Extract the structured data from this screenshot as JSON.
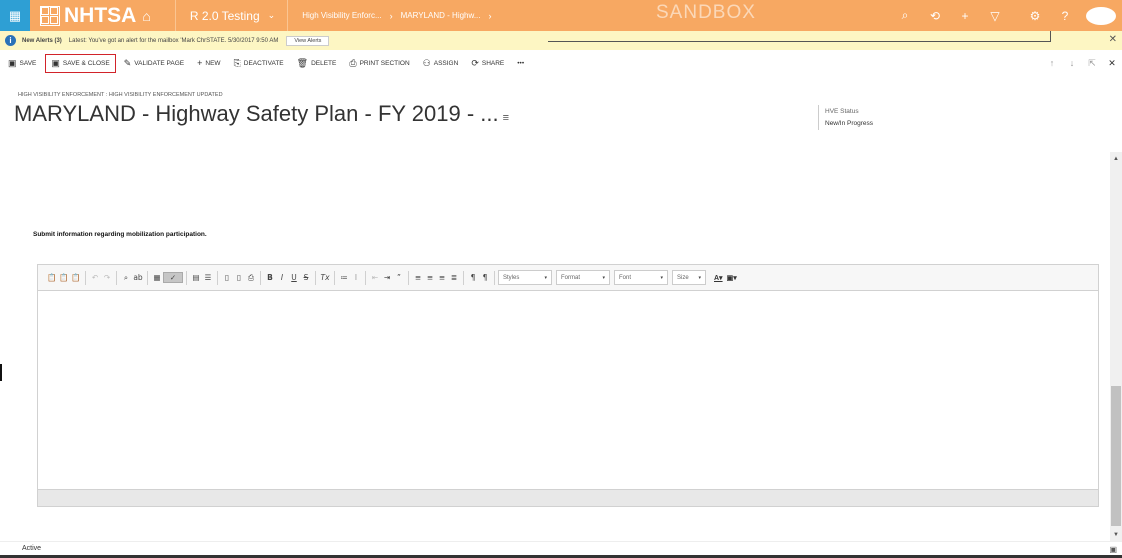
{
  "nav": {
    "logo": "NHTSA",
    "app_name": "R 2.0 Testing",
    "crumb_entity": "High Visibility Enforc...",
    "crumb_record": "MARYLAND - Highw...",
    "watermark": "SANDBOX",
    "brand_color": "#f7a862",
    "waffle_color": "#2e9fd4"
  },
  "alerts": {
    "title": "New Alerts (3)",
    "message": "Latest: You've got an alert for the mailbox 'Mark ChrSTATE. 5/30/2017 9:50 AM",
    "view_label": "View Alerts"
  },
  "commands": {
    "save": "SAVE",
    "save_close": "SAVE & CLOSE",
    "validate": "VALIDATE PAGE",
    "new": "NEW",
    "deactivate": "DEACTIVATE",
    "delete": "DELETE",
    "print": "PRINT SECTION",
    "assign": "ASSIGN",
    "share": "SHARE",
    "more": "•••"
  },
  "record": {
    "entity_path": "HIGH VISIBILITY ENFORCEMENT : HIGH VISIBILITY ENFORCEMENT UPDATED",
    "title": "MARYLAND - Highway Safety Plan - FY 2019 - ...",
    "status_label": "HVE Status",
    "status_value": "New/In Progress"
  },
  "form": {
    "section_label": "Submit information regarding mobilization participation."
  },
  "editor": {
    "styles": "Styles",
    "format": "Format",
    "font": "Font",
    "size": "Size"
  },
  "footer": {
    "status": "Active"
  }
}
